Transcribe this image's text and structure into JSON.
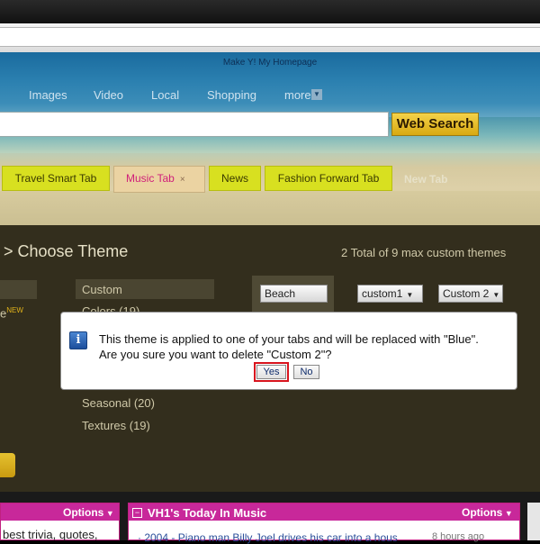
{
  "header": {
    "site_name": "Make Y! My Homepage",
    "nav": [
      "Images",
      "Video",
      "Local",
      "Shopping",
      "more"
    ],
    "search_button": "Web Search"
  },
  "tabs": {
    "items": [
      "Travel Smart Tab",
      "Music Tab",
      "News",
      "Fashion Forward Tab"
    ],
    "active": "Music Tab",
    "new_tab": "New Tab",
    "close_glyph": "×"
  },
  "theme_panel": {
    "title": "> Choose Theme",
    "total": "2 Total of 9 max custom themes",
    "left_item": "e",
    "left_new": "NEW",
    "categories": [
      "Custom",
      "Colors (19)",
      "Seasonal (20)",
      "Textures (19)"
    ],
    "themes": [
      "Beach",
      "custom1",
      "Custom 2"
    ]
  },
  "dialog": {
    "line1": "This theme is applied to one of your tabs and will be replaced with \"Blue\".",
    "line2": "Are you sure you want to delete \"Custom 2\"?",
    "yes": "Yes",
    "no": "No",
    "icon": "info-icon"
  },
  "widgets": {
    "left": {
      "options": "Options",
      "text": "best trivia, quotes,"
    },
    "right": {
      "title": "VH1's Today In Music",
      "options": "Options",
      "item": "· 2004 - Piano man Billy Joel drives his car into a hous",
      "time": "8 hours ago"
    }
  },
  "colors": {
    "accent_magenta": "#c8289a",
    "tab_yellow": "#d8e020",
    "highlight_red": "#d8141e"
  }
}
